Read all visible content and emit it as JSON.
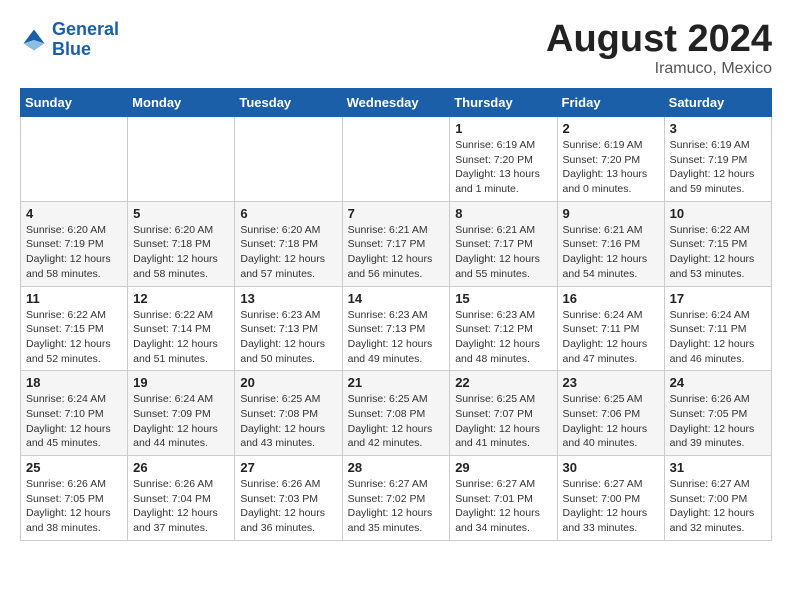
{
  "header": {
    "logo_line1": "General",
    "logo_line2": "Blue",
    "month_year": "August 2024",
    "location": "Iramuco, Mexico"
  },
  "calendar": {
    "weekdays": [
      "Sunday",
      "Monday",
      "Tuesday",
      "Wednesday",
      "Thursday",
      "Friday",
      "Saturday"
    ],
    "weeks": [
      [
        {
          "day": "",
          "info": ""
        },
        {
          "day": "",
          "info": ""
        },
        {
          "day": "",
          "info": ""
        },
        {
          "day": "",
          "info": ""
        },
        {
          "day": "1",
          "info": "Sunrise: 6:19 AM\nSunset: 7:20 PM\nDaylight: 13 hours\nand 1 minute."
        },
        {
          "day": "2",
          "info": "Sunrise: 6:19 AM\nSunset: 7:20 PM\nDaylight: 13 hours\nand 0 minutes."
        },
        {
          "day": "3",
          "info": "Sunrise: 6:19 AM\nSunset: 7:19 PM\nDaylight: 12 hours\nand 59 minutes."
        }
      ],
      [
        {
          "day": "4",
          "info": "Sunrise: 6:20 AM\nSunset: 7:19 PM\nDaylight: 12 hours\nand 58 minutes."
        },
        {
          "day": "5",
          "info": "Sunrise: 6:20 AM\nSunset: 7:18 PM\nDaylight: 12 hours\nand 58 minutes."
        },
        {
          "day": "6",
          "info": "Sunrise: 6:20 AM\nSunset: 7:18 PM\nDaylight: 12 hours\nand 57 minutes."
        },
        {
          "day": "7",
          "info": "Sunrise: 6:21 AM\nSunset: 7:17 PM\nDaylight: 12 hours\nand 56 minutes."
        },
        {
          "day": "8",
          "info": "Sunrise: 6:21 AM\nSunset: 7:17 PM\nDaylight: 12 hours\nand 55 minutes."
        },
        {
          "day": "9",
          "info": "Sunrise: 6:21 AM\nSunset: 7:16 PM\nDaylight: 12 hours\nand 54 minutes."
        },
        {
          "day": "10",
          "info": "Sunrise: 6:22 AM\nSunset: 7:15 PM\nDaylight: 12 hours\nand 53 minutes."
        }
      ],
      [
        {
          "day": "11",
          "info": "Sunrise: 6:22 AM\nSunset: 7:15 PM\nDaylight: 12 hours\nand 52 minutes."
        },
        {
          "day": "12",
          "info": "Sunrise: 6:22 AM\nSunset: 7:14 PM\nDaylight: 12 hours\nand 51 minutes."
        },
        {
          "day": "13",
          "info": "Sunrise: 6:23 AM\nSunset: 7:13 PM\nDaylight: 12 hours\nand 50 minutes."
        },
        {
          "day": "14",
          "info": "Sunrise: 6:23 AM\nSunset: 7:13 PM\nDaylight: 12 hours\nand 49 minutes."
        },
        {
          "day": "15",
          "info": "Sunrise: 6:23 AM\nSunset: 7:12 PM\nDaylight: 12 hours\nand 48 minutes."
        },
        {
          "day": "16",
          "info": "Sunrise: 6:24 AM\nSunset: 7:11 PM\nDaylight: 12 hours\nand 47 minutes."
        },
        {
          "day": "17",
          "info": "Sunrise: 6:24 AM\nSunset: 7:11 PM\nDaylight: 12 hours\nand 46 minutes."
        }
      ],
      [
        {
          "day": "18",
          "info": "Sunrise: 6:24 AM\nSunset: 7:10 PM\nDaylight: 12 hours\nand 45 minutes."
        },
        {
          "day": "19",
          "info": "Sunrise: 6:24 AM\nSunset: 7:09 PM\nDaylight: 12 hours\nand 44 minutes."
        },
        {
          "day": "20",
          "info": "Sunrise: 6:25 AM\nSunset: 7:08 PM\nDaylight: 12 hours\nand 43 minutes."
        },
        {
          "day": "21",
          "info": "Sunrise: 6:25 AM\nSunset: 7:08 PM\nDaylight: 12 hours\nand 42 minutes."
        },
        {
          "day": "22",
          "info": "Sunrise: 6:25 AM\nSunset: 7:07 PM\nDaylight: 12 hours\nand 41 minutes."
        },
        {
          "day": "23",
          "info": "Sunrise: 6:25 AM\nSunset: 7:06 PM\nDaylight: 12 hours\nand 40 minutes."
        },
        {
          "day": "24",
          "info": "Sunrise: 6:26 AM\nSunset: 7:05 PM\nDaylight: 12 hours\nand 39 minutes."
        }
      ],
      [
        {
          "day": "25",
          "info": "Sunrise: 6:26 AM\nSunset: 7:05 PM\nDaylight: 12 hours\nand 38 minutes."
        },
        {
          "day": "26",
          "info": "Sunrise: 6:26 AM\nSunset: 7:04 PM\nDaylight: 12 hours\nand 37 minutes."
        },
        {
          "day": "27",
          "info": "Sunrise: 6:26 AM\nSunset: 7:03 PM\nDaylight: 12 hours\nand 36 minutes."
        },
        {
          "day": "28",
          "info": "Sunrise: 6:27 AM\nSunset: 7:02 PM\nDaylight: 12 hours\nand 35 minutes."
        },
        {
          "day": "29",
          "info": "Sunrise: 6:27 AM\nSunset: 7:01 PM\nDaylight: 12 hours\nand 34 minutes."
        },
        {
          "day": "30",
          "info": "Sunrise: 6:27 AM\nSunset: 7:00 PM\nDaylight: 12 hours\nand 33 minutes."
        },
        {
          "day": "31",
          "info": "Sunrise: 6:27 AM\nSunset: 7:00 PM\nDaylight: 12 hours\nand 32 minutes."
        }
      ]
    ]
  }
}
